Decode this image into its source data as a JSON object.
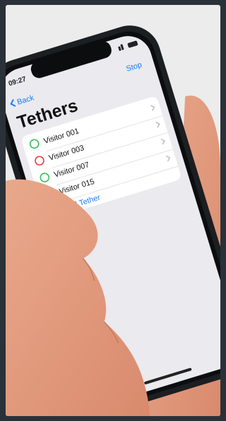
{
  "status": {
    "time": "09:27"
  },
  "nav": {
    "back_label": "Back",
    "stop_label": "Stop"
  },
  "title": "Tethers",
  "tethers": [
    {
      "label": "Visitor 001",
      "status": "green"
    },
    {
      "label": "Visitor 003",
      "status": "red"
    },
    {
      "label": "Visitor 007",
      "status": "green"
    },
    {
      "label": "Visitor 015",
      "status": "green"
    }
  ],
  "add_label": "Add Tether",
  "colors": {
    "accent": "#1a7cf5",
    "green": "#35c15a",
    "red": "#ec3b3b",
    "background": "#2b3138",
    "screen": "#ebeaee"
  }
}
